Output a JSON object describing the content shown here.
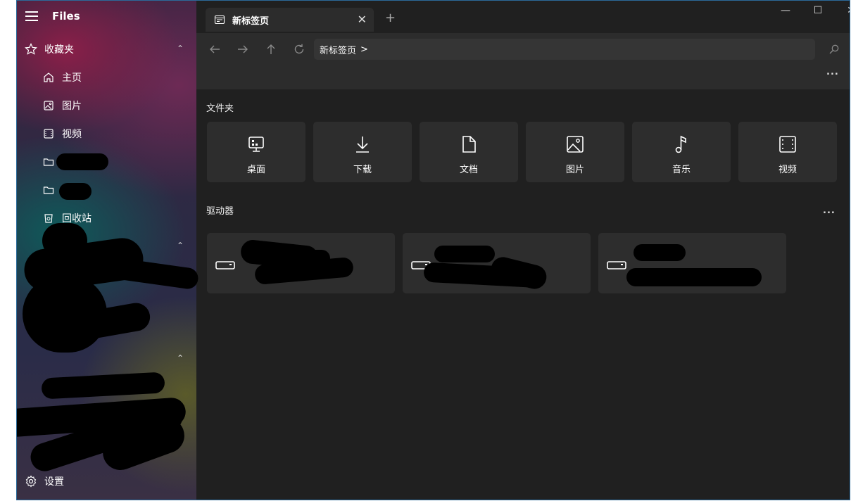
{
  "app": {
    "title": "Files"
  },
  "sidebar": {
    "favorites_label": "收藏夹",
    "items": [
      {
        "label": "主页",
        "icon": "home-icon"
      },
      {
        "label": "图片",
        "icon": "image-icon"
      },
      {
        "label": "视频",
        "icon": "video-icon"
      },
      {
        "label": "",
        "icon": "folder-icon"
      },
      {
        "label": "",
        "icon": "folder-icon"
      },
      {
        "label": "回收站",
        "icon": "recycle-bin-icon"
      }
    ],
    "settings_label": "设置"
  },
  "tabs": [
    {
      "label": "新标签页"
    }
  ],
  "address": {
    "breadcrumb": "新标签页",
    "separator": ">"
  },
  "content": {
    "folders_title": "文件夹",
    "folders": [
      {
        "label": "桌面",
        "icon": "desktop-icon"
      },
      {
        "label": "下载",
        "icon": "download-icon"
      },
      {
        "label": "文档",
        "icon": "document-icon"
      },
      {
        "label": "图片",
        "icon": "image-icon"
      },
      {
        "label": "音乐",
        "icon": "music-icon"
      },
      {
        "label": "视频",
        "icon": "video-icon"
      }
    ],
    "drives_title": "驱动器",
    "more_label": "..."
  },
  "colors": {
    "accent_border": "#2b6a9a",
    "background": "#202020",
    "card": "#2d2d2d"
  }
}
